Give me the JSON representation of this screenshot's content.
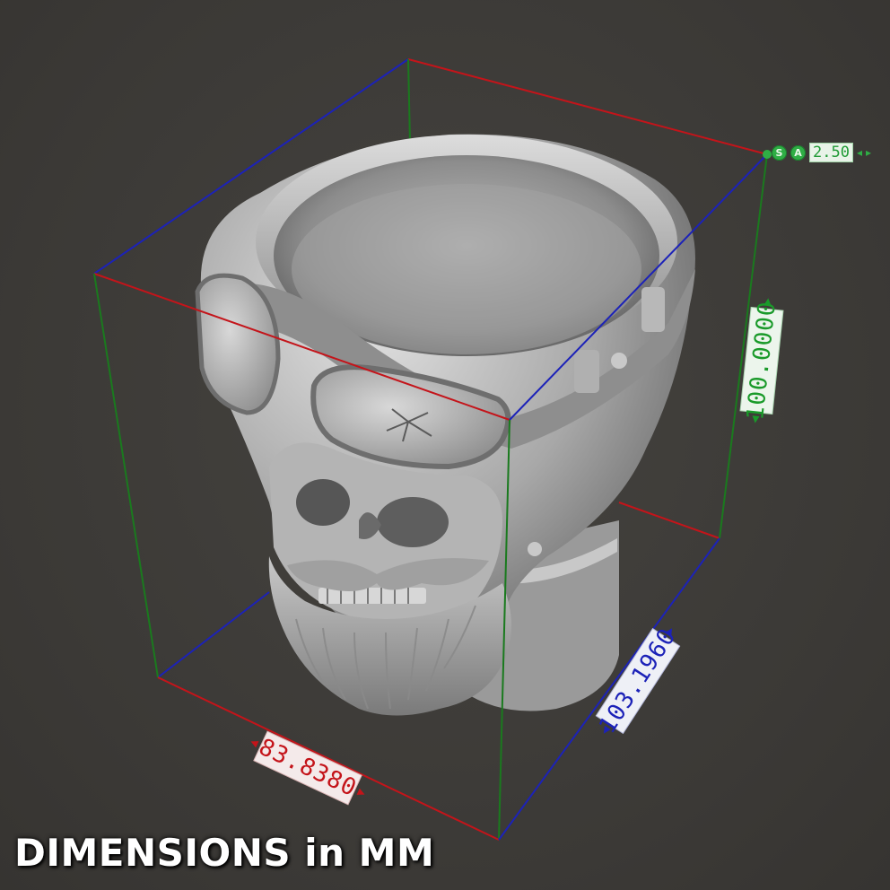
{
  "caption": "DIMENSIONS in MM",
  "dimensions": {
    "width_label": "83.8380",
    "depth_label": "103.1960",
    "height_label": "100.0000"
  },
  "snap_controls": {
    "s_button": "S",
    "a_button": "A",
    "step_value": "2.50",
    "left_arrow": "◂",
    "right_arrow": "▸"
  },
  "colors": {
    "background": "#3d3b37",
    "x_axis": "#c4141a",
    "y_axis": "#1a7a1e",
    "z_axis": "#1c22b8",
    "width_text": "#c4141a",
    "depth_text": "#1c22b8",
    "height_text": "#1a9a2a",
    "model_light": "#d6d6d6",
    "model_dark": "#5a5a5a"
  }
}
